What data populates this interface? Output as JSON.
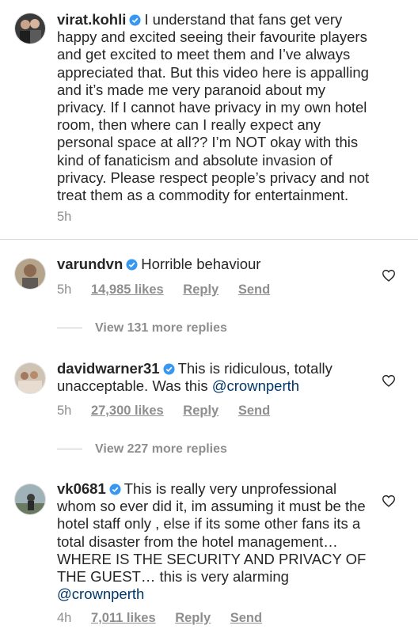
{
  "caption": {
    "username": "virat.kohli",
    "text": "I understand that fans get very happy and excited seeing their favourite players and get excited to meet them and I’ve always appreciated that. But this video here is appalling and it’s made me very paranoid about my privacy. If I cannot have privacy in my own hotel room, then where can I really expect any personal space at all?? I’m NOT okay with this kind of fanaticism and absolute invasion of privacy. Please respect people’s privacy and not treat them as a commodity for entertainment.",
    "time": "5h"
  },
  "comments": [
    {
      "username": "varundvn",
      "text": "Horrible behaviour",
      "mention": "",
      "time": "5h",
      "likes": "14,985 likes",
      "reply": "Reply",
      "send": "Send",
      "view_replies": "View 131 more replies"
    },
    {
      "username": "davidwarner31",
      "text": "This is ridiculous, totally unacceptable. Was this ",
      "mention": "@crownperth",
      "time": "5h",
      "likes": "27,300 likes",
      "reply": "Reply",
      "send": "Send",
      "view_replies": "View 227 more replies"
    },
    {
      "username": "vk0681",
      "text": "This is really very unprofessional whom so ever did it, im assuming it must be the hotel staff only , else if its some other fans its a total disaster from the hotel management… WHERE IS THE SECURITY AND PRIVACY OF THE GUEST… this is very alarming ",
      "mention": "@crownperth",
      "time": "4h",
      "likes": "7,011 likes",
      "reply": "Reply",
      "send": "Send"
    }
  ],
  "icons": {
    "verified": "verified-badge-icon",
    "like": "heart-icon"
  },
  "colors": {
    "verified": "#3897f0",
    "mention": "#00376b",
    "secondary_text": "#8e8e8e"
  }
}
